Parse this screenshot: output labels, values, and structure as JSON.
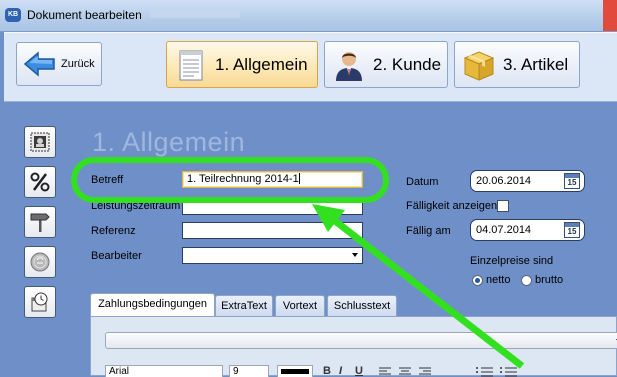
{
  "window": {
    "title": "Dokument bearbeiten",
    "logo_text": "KB"
  },
  "toolbar": {
    "back_label": "Zurück",
    "tabs": [
      {
        "label": "1. Allgemein",
        "active": true,
        "icon": "notepad-icon"
      },
      {
        "label": "2. Kunde",
        "active": false,
        "icon": "person-icon"
      },
      {
        "label": "3. Artikel",
        "active": false,
        "icon": "box-icon"
      }
    ]
  },
  "sidebar": {
    "items": [
      {
        "icon": "stamp-icon"
      },
      {
        "icon": "percent-icon"
      },
      {
        "icon": "signpost-icon"
      },
      {
        "icon": "coin-icon"
      },
      {
        "icon": "clock-icon"
      }
    ]
  },
  "section": {
    "title": "1. Allgemein"
  },
  "form": {
    "betreff_label": "Betreff",
    "betreff_value": "1. Teilrechnung 2014-1",
    "leistungszeitraum_label": "Leistungszeitraum",
    "leistungszeitraum_value": "",
    "referenz_label": "Referenz",
    "referenz_value": "",
    "bearbeiter_label": "Bearbeiter",
    "bearbeiter_value": "",
    "datum_label": "Datum",
    "datum_value": "20.06.2014",
    "calendar_day": "15",
    "faelligkeit_anzeigen_label": "Fälligkeit anzeigen",
    "faelligkeit_anzeigen_checked": false,
    "faellig_am_label": "Fällig am",
    "faellig_am_value": "04.07.2014",
    "einzelpreise_label": "Einzelpreise sind",
    "netto_label": "netto",
    "brutto_label": "brutto",
    "price_mode": "netto"
  },
  "bottom_tabs": [
    {
      "label": "Zahlungsbedingungen",
      "active": true
    },
    {
      "label": "ExtraText",
      "active": false
    },
    {
      "label": "Vortext",
      "active": false
    },
    {
      "label": "Schlusstext",
      "active": false
    }
  ],
  "editor": {
    "conditions_value": "",
    "font_value": "Arial",
    "size_value": "9",
    "bold_label": "B",
    "italic_label": "I",
    "underline_label": "U"
  },
  "annotation": {
    "color": "#33e01f"
  },
  "colors": {
    "background": "#6f8fc8",
    "active_tab": "#fde9b8",
    "section_title": "#9fb7de"
  }
}
